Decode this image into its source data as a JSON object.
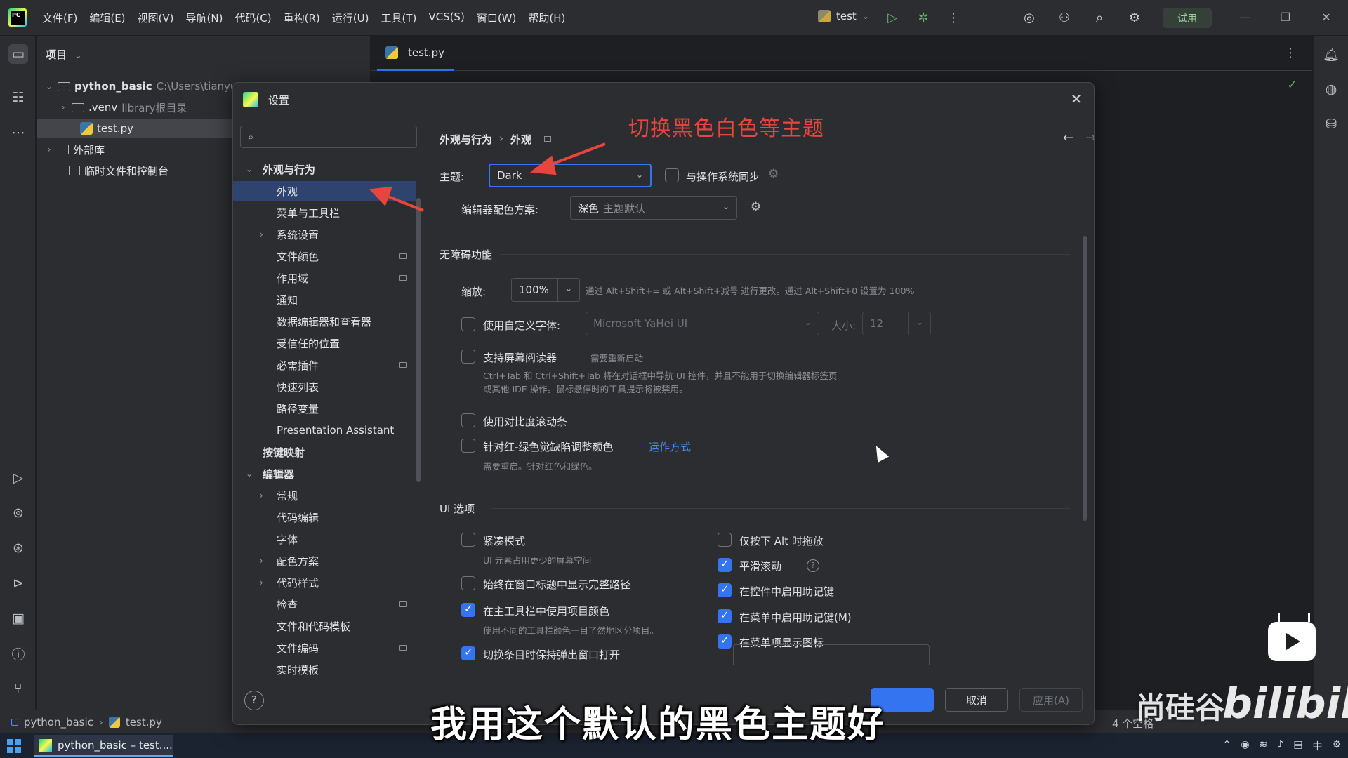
{
  "app": {
    "menu": [
      "文件(F)",
      "编辑(E)",
      "视图(V)",
      "导航(N)",
      "代码(C)",
      "重构(R)",
      "运行(U)",
      "工具(T)",
      "VCS(S)",
      "窗口(W)",
      "帮助(H)"
    ],
    "run_config": "test",
    "trial_label": "试用"
  },
  "project_panel": {
    "header": "项目",
    "tree": [
      {
        "label": "python_basic",
        "note": "C:\\Users\\tianyu",
        "arrow": "⌄"
      },
      {
        "label": ".venv",
        "note": "library根目录",
        "arrow": "›"
      },
      {
        "label": "test.py",
        "note": "",
        "arrow": ""
      },
      {
        "label": "外部库",
        "note": "",
        "arrow": "›"
      },
      {
        "label": "临时文件和控制台",
        "note": "",
        "arrow": ""
      }
    ]
  },
  "editor": {
    "tab_label": "test.py"
  },
  "settings": {
    "title": "设置",
    "search_placeholder": "",
    "breadcrumb": {
      "parent": "外观与行为",
      "current": "外观"
    },
    "nav": [
      {
        "label": "外观与行为",
        "level": 0,
        "arrow": "⌄",
        "bold": true,
        "mark": false,
        "selected": false
      },
      {
        "label": "外观",
        "level": 1,
        "arrow": "",
        "bold": false,
        "mark": false,
        "selected": true
      },
      {
        "label": "菜单与工具栏",
        "level": 1,
        "arrow": "",
        "bold": false,
        "mark": false,
        "selected": false
      },
      {
        "label": "系统设置",
        "level": 1,
        "arrow": "›",
        "bold": false,
        "mark": false,
        "selected": false
      },
      {
        "label": "文件颜色",
        "level": 1,
        "arrow": "",
        "bold": false,
        "mark": true,
        "selected": false
      },
      {
        "label": "作用域",
        "level": 1,
        "arrow": "",
        "bold": false,
        "mark": true,
        "selected": false
      },
      {
        "label": "通知",
        "level": 1,
        "arrow": "",
        "bold": false,
        "mark": false,
        "selected": false
      },
      {
        "label": "数据编辑器和查看器",
        "level": 1,
        "arrow": "",
        "bold": false,
        "mark": false,
        "selected": false
      },
      {
        "label": "受信任的位置",
        "level": 1,
        "arrow": "",
        "bold": false,
        "mark": false,
        "selected": false
      },
      {
        "label": "必需插件",
        "level": 1,
        "arrow": "",
        "bold": false,
        "mark": true,
        "selected": false
      },
      {
        "label": "快速列表",
        "level": 1,
        "arrow": "",
        "bold": false,
        "mark": false,
        "selected": false
      },
      {
        "label": "路径变量",
        "level": 1,
        "arrow": "",
        "bold": false,
        "mark": false,
        "selected": false
      },
      {
        "label": "Presentation Assistant",
        "level": 1,
        "arrow": "",
        "bold": false,
        "mark": false,
        "selected": false
      },
      {
        "label": "按键映射",
        "level": 0,
        "arrow": "",
        "bold": true,
        "mark": false,
        "selected": false
      },
      {
        "label": "编辑器",
        "level": 0,
        "arrow": "⌄",
        "bold": true,
        "mark": false,
        "selected": false
      },
      {
        "label": "常规",
        "level": 1,
        "arrow": "›",
        "bold": false,
        "mark": false,
        "selected": false
      },
      {
        "label": "代码编辑",
        "level": 1,
        "arrow": "",
        "bold": false,
        "mark": false,
        "selected": false
      },
      {
        "label": "字体",
        "level": 1,
        "arrow": "",
        "bold": false,
        "mark": false,
        "selected": false
      },
      {
        "label": "配色方案",
        "level": 1,
        "arrow": "›",
        "bold": false,
        "mark": false,
        "selected": false
      },
      {
        "label": "代码样式",
        "level": 1,
        "arrow": "›",
        "bold": false,
        "mark": false,
        "selected": false
      },
      {
        "label": "检查",
        "level": 1,
        "arrow": "",
        "bold": false,
        "mark": true,
        "selected": false
      },
      {
        "label": "文件和代码模板",
        "level": 1,
        "arrow": "",
        "bold": false,
        "mark": false,
        "selected": false
      },
      {
        "label": "文件编码",
        "level": 1,
        "arrow": "",
        "bold": false,
        "mark": true,
        "selected": false
      },
      {
        "label": "实时模板",
        "level": 1,
        "arrow": "",
        "bold": false,
        "mark": false,
        "selected": false
      }
    ],
    "theme": {
      "label": "主题:",
      "value": "Dark",
      "sync_label": "与操作系统同步",
      "sync_checked": false
    },
    "scheme": {
      "label": "编辑器配色方案:",
      "value": "深色",
      "value_hint": "主题默认"
    },
    "accessibility": {
      "section": "无障碍功能",
      "zoom_label": "缩放:",
      "zoom_value": "100%",
      "zoom_hint": "通过 Alt+Shift+= 或 Alt+Shift+减号 进行更改。通过 Alt+Shift+0 设置为 100%",
      "custom_font_label": "使用自定义字体:",
      "custom_font_checked": false,
      "custom_font_value": "Microsoft YaHei UI",
      "size_label": "大小:",
      "size_value": "12",
      "screen_reader_label": "支持屏幕阅读器",
      "screen_reader_checked": false,
      "screen_reader_note": "需要重新启动",
      "screen_reader_hint_1": "Ctrl+Tab 和 Ctrl+Shift+Tab 将在对话框中导航 UI 控件，并且不能用于切换编辑器标签页",
      "screen_reader_hint_2": "或其他 IDE 操作。鼠标悬停时的工具提示将被禁用。",
      "contrast_scrollbar_label": "使用对比度滚动条",
      "contrast_scrollbar_checked": false,
      "color_deficiency_label": "针对红-绿色觉缺陷调整颜色",
      "color_deficiency_checked": false,
      "color_deficiency_link": "运作方式",
      "color_deficiency_hint": "需要重启。针对红色和绿色。"
    },
    "ui_options": {
      "section": "UI 选项",
      "left": [
        {
          "label": "紧凑模式",
          "checked": false,
          "hint": "UI 元素占用更少的屏幕空间"
        },
        {
          "label": "始终在窗口标题中显示完整路径",
          "checked": false,
          "hint": ""
        },
        {
          "label": "在主工具栏中使用项目颜色",
          "checked": true,
          "hint": "使用不同的工具栏颜色一目了然地区分项目。"
        },
        {
          "label": "切换条目时保持弹出窗口打开",
          "checked": true,
          "hint": ""
        }
      ],
      "right": [
        {
          "label": "仅按下 Alt 时拖放",
          "checked": false,
          "help": false
        },
        {
          "label": "平滑滚动",
          "checked": true,
          "help": true
        },
        {
          "label": "在控件中启用助记键",
          "checked": true,
          "help": false
        },
        {
          "label": "在菜单中启用助记键(M)",
          "checked": true,
          "help": false
        },
        {
          "label": "在菜单项显示图标",
          "checked": true,
          "help": false
        }
      ]
    },
    "footer": {
      "help": "?",
      "ok": "",
      "cancel": "取消",
      "apply": "应用(A)"
    }
  },
  "statusbar": {
    "project": "python_basic",
    "file": "test.py",
    "right_text": "4 个空格"
  },
  "taskbar": {
    "app_label": "python_basic – test...."
  },
  "overlays": {
    "annotation": "切换黑色白色等主题",
    "subtitle": "我用这个默认的黑色主题好",
    "watermark": "尚硅谷",
    "watermark_brand": "bilibili"
  }
}
